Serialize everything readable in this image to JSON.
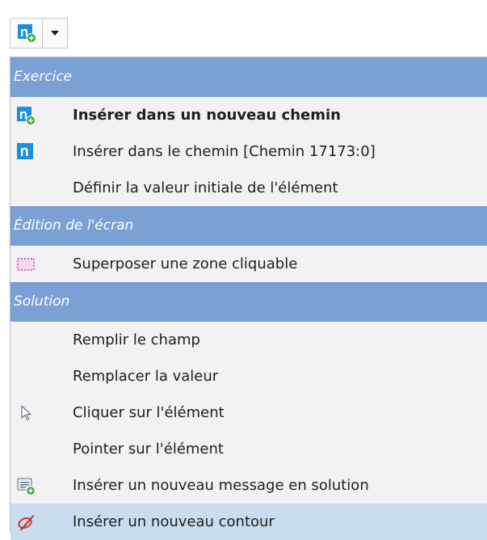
{
  "toolbar": {
    "main_icon": "insert-new-path-icon",
    "dropdown_icon": "chevron-down-icon"
  },
  "menu": {
    "sections": [
      {
        "header": "Exercice",
        "items": [
          {
            "label": "Insérer dans un nouveau chemin",
            "icon": "insert-new-path-icon",
            "bold": true
          },
          {
            "label": "Insérer dans le chemin [Chemin 17173:0]",
            "icon": "path-n-icon"
          },
          {
            "label": "Définir la valeur initiale de l'élément"
          }
        ]
      },
      {
        "header": "Édition de l'écran",
        "items": [
          {
            "label": "Superposer une zone cliquable",
            "icon": "clickable-zone-icon"
          }
        ]
      },
      {
        "header": "Solution",
        "items": [
          {
            "label": "Remplir le champ"
          },
          {
            "label": "Remplacer la valeur"
          },
          {
            "label": "Cliquer sur l'élément",
            "icon": "cursor-arrow-icon"
          },
          {
            "label": "Pointer sur l'élément"
          },
          {
            "label": "Insérer un nouveau message en solution",
            "icon": "new-message-icon"
          },
          {
            "label": "Insérer un nouveau contour",
            "icon": "new-outline-icon",
            "highlighted": true
          }
        ]
      }
    ]
  },
  "colors": {
    "header_bg": "#7ba1d4",
    "menu_bg": "#f2f2f2",
    "highlight_bg": "#c9ddef",
    "icon_blue": "#1c8fe0",
    "icon_green": "#33a532"
  }
}
